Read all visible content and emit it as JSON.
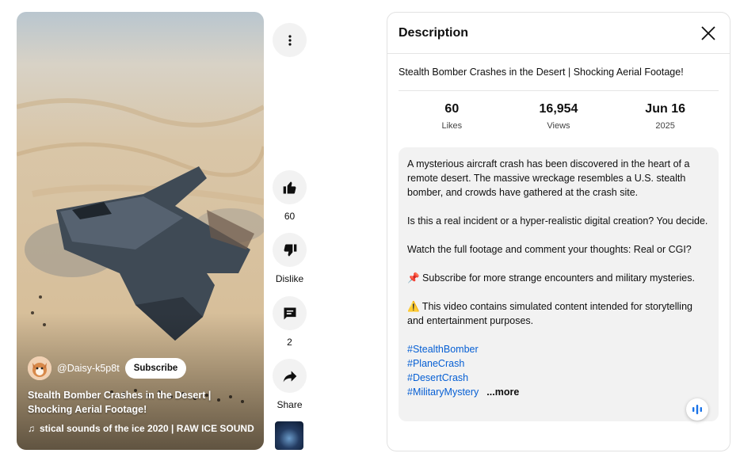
{
  "video": {
    "channel_handle": "@Daisy-k5p8t",
    "subscribe_label": "Subscribe",
    "title": "Stealth Bomber Crashes in the Desert | Shocking Aerial Footage!",
    "sound": "stical sounds of the ice 2020 | RAW ICE SOUND"
  },
  "rail": {
    "likes": "60",
    "dislike_label": "Dislike",
    "comments": "2",
    "share_label": "Share"
  },
  "panel": {
    "title": "Description",
    "video_title": "Stealth Bomber Crashes in the Desert | Shocking Aerial Footage!",
    "stats": [
      {
        "value": "60",
        "label": "Likes"
      },
      {
        "value": "16,954",
        "label": "Views"
      },
      {
        "value": "Jun 16",
        "label": "2025"
      }
    ],
    "description": {
      "para1": "A mysterious aircraft crash has been discovered in the heart of a remote desert. The massive wreckage resembles a U.S. stealth bomber, and crowds have gathered at the crash site.",
      "para2": "Is this a real incident or a hyper-realistic digital creation? You decide.",
      "para3": "Watch the full footage and comment your thoughts: Real or CGI?",
      "para4": "📌 Subscribe for more strange encounters and military mysteries.",
      "para5": "⚠️ This video contains simulated content intended for storytelling and entertainment purposes.",
      "hashtags": [
        "#StealthBomber",
        "#PlaneCrash",
        "#DesertCrash",
        "#MilitaryMystery"
      ],
      "more_label": "...more"
    }
  },
  "icons": {
    "menu": "more-vert-icon",
    "like": "thumbs-up-icon",
    "dislike": "thumbs-down-icon",
    "comments": "comment-icon",
    "share": "share-arrow-icon",
    "close": "close-icon",
    "voice": "audio-wave-icon"
  },
  "colors": {
    "link": "#065fd4",
    "button_bg": "#f2f2f2",
    "desc_bg": "#f2f2f2"
  }
}
